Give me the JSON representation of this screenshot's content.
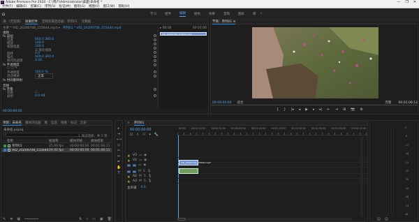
{
  "window": {
    "title": "Adobe Premiere Pro 2020 - C:\\用户\\Administrator\\桌面\\未命名 *",
    "logo": "Pr",
    "controls": [
      "—",
      "❐",
      "✕"
    ]
  },
  "menubar": [
    "文件(F)",
    "编辑(E)",
    "剪辑(C)",
    "序列(S)",
    "标记(M)",
    "图形(G)",
    "视图(V)",
    "窗口(W)",
    "帮助(H)"
  ],
  "workspaces": {
    "home_icon": "home-icon",
    "tabs": [
      "学习",
      "组件",
      "编辑",
      "颜色",
      "效果",
      "音频",
      "图形",
      "库"
    ],
    "active": "编辑"
  },
  "source_panel": {
    "tabs": [
      "源：(无剪辑)",
      "效果控件",
      "音频剪辑混合器：序列01",
      "元数据"
    ],
    "active_tab": "效果控件",
    "master_line": "主要 * VID_20200708_155644.mp4 ▾",
    "clip_link": "序列01 * VID_20200708_155644.mp4",
    "sections": [
      {
        "label": "视频",
        "header": true
      },
      {
        "label": "fx 运动",
        "header": true
      },
      {
        "label": "位置",
        "value": "640.0   360.0"
      },
      {
        "label": "缩放",
        "value": "100.0"
      },
      {
        "label": "缩放宽度",
        "value": "100.0"
      },
      {
        "label": "",
        "value": "☑ 等比缩放"
      },
      {
        "label": "旋转",
        "value": "0.0"
      },
      {
        "label": "锚点",
        "value": "640.0   360.0"
      },
      {
        "label": "防闪烁滤镜",
        "value": "0.00"
      },
      {
        "label": "fx 不透明度",
        "header": true
      },
      {
        "label": "○ □ ✎",
        "value": ""
      },
      {
        "label": "不透明度",
        "value": "100.0 %"
      },
      {
        "label": "混合模式",
        "value": "正常"
      },
      {
        "label": "fx 时间重映射",
        "header": true
      },
      {
        "label": "音频",
        "header": true
      },
      {
        "label": "fx 音量",
        "header": true
      },
      {
        "label": "旁路",
        "value": "☐"
      },
      {
        "label": "级别",
        "value": "0.0 dB"
      }
    ],
    "mini_timeline": {
      "ruler": [
        "▸ 00:00",
        "00:01:00"
      ],
      "clip": "VID_20200708_155644.mp4"
    },
    "timecode": "00:00:00:00"
  },
  "program_monitor": {
    "title": "节目：序列01 ≡",
    "timecode_left": "00:00:00:00",
    "fit_label": "适合",
    "quality": "完整",
    "timecode_right": "00:01:06:12",
    "controls": [
      "{",
      "}",
      "|◂",
      "◂",
      "▶",
      "▸",
      "▸|",
      "⇤",
      "⇥",
      "⊞",
      "📷",
      "⚙"
    ]
  },
  "project_panel": {
    "tabs": [
      "项目：未命名",
      "媒体浏览器",
      "库",
      "信息",
      "效果",
      "标记",
      "历史"
    ],
    "active_tab": "项目：未命名",
    "file": "未命名.prproj",
    "count": "1 项已选择，共 2 项",
    "columns": [
      "名称",
      "帧速率",
      "媒体开始",
      "媒体结束"
    ],
    "items": [
      {
        "name": "序列01",
        "fps": "25.00 fps",
        "start": "00:00:00:00",
        "end": "00:01:06:11",
        "color": "#2f9e44"
      },
      {
        "name": "VID_20200708_155644.mp4",
        "fps": "29.00 fps",
        "start": "00:00:00:00",
        "end": "00:01:06:11",
        "color": "#3a79c9"
      }
    ],
    "bottom_icons": [
      "pencil-icon",
      "list-view-icon",
      "icon-view-icon",
      "zoom-slider",
      "sort-icon",
      "search-icon",
      "folder-icon",
      "new-item-icon",
      "trash-icon"
    ]
  },
  "tools": [
    "▸",
    "⇥",
    "⟷",
    "◇",
    "✂",
    "↔",
    "✒",
    "✋",
    "T"
  ],
  "timeline": {
    "tab": "序列01",
    "timecode": "00:00:00:00",
    "ruler": [
      "00:00",
      "00:00:15:00",
      "00:00:30:00",
      "00:00:45:00",
      "00:01:00:00",
      "00:01:15:00",
      "00:01:30:00",
      "00:01:45:00",
      "00:02:00:00",
      "00:02:15:00"
    ],
    "tracks_video": [
      "V3",
      "V2",
      "V1"
    ],
    "tracks_audio": [
      "A1",
      "A2",
      "A3"
    ],
    "master": "主声道",
    "master_value": "0.0",
    "video_clip": "VID_20200708_155644.mp4",
    "audio_clip": ""
  },
  "meters": {
    "labels": [
      "0",
      "-6",
      "-12",
      "-18",
      "-24",
      "-30",
      "-36",
      "-42",
      "-48",
      "-54",
      "dB"
    ],
    "solo": [
      "S",
      "S"
    ]
  }
}
